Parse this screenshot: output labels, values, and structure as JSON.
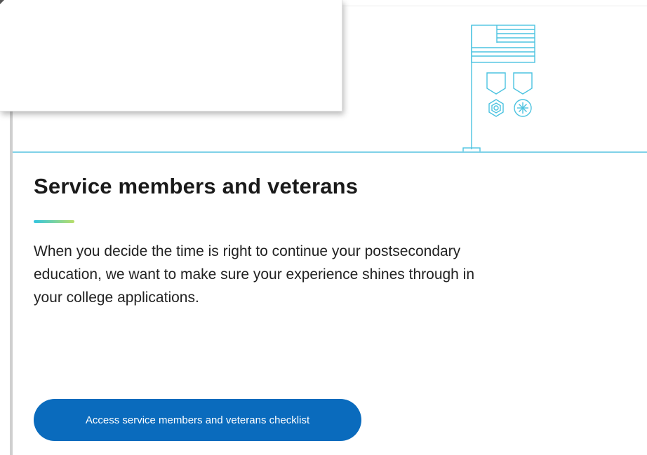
{
  "section": {
    "title": "Service members and veterans",
    "description": "When you decide the time is right to continue your postsecondary education, we want to make sure your experience shines through in your college applications.",
    "cta_label": "Access service members and veterans checklist"
  },
  "illustration": {
    "icon": "flag-medals-icon",
    "stroke_color": "#4cc3e0"
  },
  "colors": {
    "accent_rule": "#7fd1e8",
    "button_bg": "#0a6bbd",
    "accent_gradient_start": "#33c5e0",
    "accent_gradient_end": "#b9de68"
  }
}
